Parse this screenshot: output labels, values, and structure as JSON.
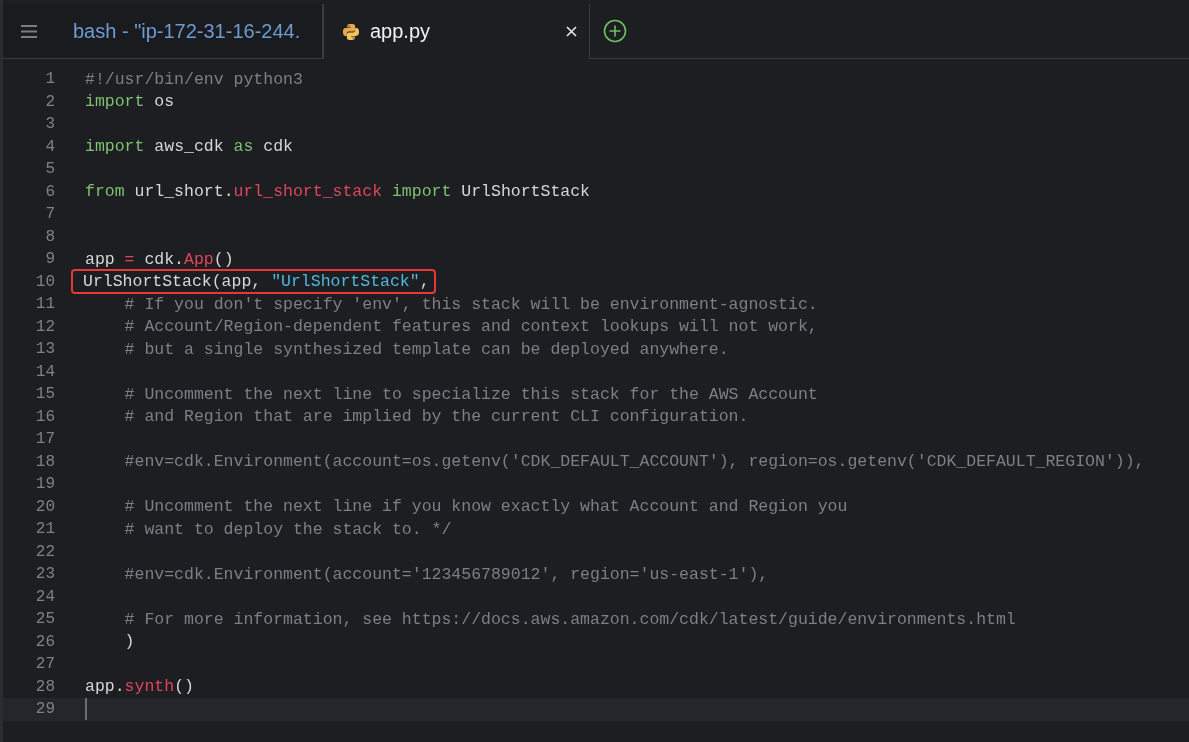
{
  "tabs": [
    {
      "label": "bash - \"ip-172-31-16-244.",
      "kind": "terminal",
      "selected": false
    },
    {
      "label": "app.py",
      "kind": "python",
      "selected": true
    }
  ],
  "editor": {
    "lines": [
      {
        "number": "1",
        "kind": "code",
        "tokens": [
          {
            "kind": "comment",
            "text": "#!/usr/bin/env python3"
          }
        ]
      },
      {
        "number": "2",
        "kind": "code",
        "tokens": [
          {
            "kind": "keyword",
            "text": "import"
          },
          {
            "kind": "plain",
            "text": " os"
          }
        ]
      },
      {
        "number": "3",
        "kind": "code"
      },
      {
        "number": "4",
        "kind": "code",
        "tokens": [
          {
            "kind": "keyword",
            "text": "import"
          },
          {
            "kind": "plain",
            "text": " aws_cdk "
          },
          {
            "kind": "keyword",
            "text": "as"
          },
          {
            "kind": "plain",
            "text": " cdk"
          }
        ]
      },
      {
        "number": "5",
        "kind": "code"
      },
      {
        "number": "6",
        "kind": "code",
        "tokens": [
          {
            "kind": "keyword",
            "text": "from"
          },
          {
            "kind": "plain",
            "text": " url_short."
          },
          {
            "kind": "member",
            "text": "url_short_stack"
          },
          {
            "kind": "keyword",
            "text": " import"
          },
          {
            "kind": "plain",
            "text": " UrlShortStack"
          }
        ]
      },
      {
        "number": "7",
        "kind": "code"
      },
      {
        "number": "8",
        "kind": "code"
      },
      {
        "number": "9",
        "kind": "code",
        "tokens": [
          {
            "kind": "plain",
            "text": "app "
          },
          {
            "kind": "member",
            "text": "="
          },
          {
            "kind": "plain",
            "text": " cdk."
          },
          {
            "kind": "member",
            "text": "App"
          },
          {
            "kind": "plain",
            "text": "()"
          }
        ]
      },
      {
        "number": "10",
        "kind": "boxed",
        "tokens": [
          {
            "kind": "plain",
            "text": "UrlShortStack(app, "
          },
          {
            "kind": "string",
            "text": "\"UrlShortStack\""
          },
          {
            "kind": "plain",
            "text": ","
          }
        ]
      },
      {
        "number": "11",
        "kind": "code",
        "tokens": [
          {
            "kind": "comment",
            "text": "    # If you don't specify 'env', this stack will be environment-agnostic."
          }
        ]
      },
      {
        "number": "12",
        "kind": "code",
        "tokens": [
          {
            "kind": "comment",
            "text": "    # Account/Region-dependent features and context lookups will not work,"
          }
        ]
      },
      {
        "number": "13",
        "kind": "code",
        "tokens": [
          {
            "kind": "comment",
            "text": "    # but a single synthesized template can be deployed anywhere."
          }
        ]
      },
      {
        "number": "14",
        "kind": "code"
      },
      {
        "number": "15",
        "kind": "code",
        "tokens": [
          {
            "kind": "comment",
            "text": "    # Uncomment the next line to specialize this stack for the AWS Account"
          }
        ]
      },
      {
        "number": "16",
        "kind": "code",
        "tokens": [
          {
            "kind": "comment",
            "text": "    # and Region that are implied by the current CLI configuration."
          }
        ]
      },
      {
        "number": "17",
        "kind": "code"
      },
      {
        "number": "18",
        "kind": "code",
        "tokens": [
          {
            "kind": "comment",
            "text": "    #env=cdk.Environment(account=os.getenv('CDK_DEFAULT_ACCOUNT'), region=os.getenv('CDK_DEFAULT_REGION')),"
          }
        ]
      },
      {
        "number": "19",
        "kind": "code"
      },
      {
        "number": "20",
        "kind": "code",
        "tokens": [
          {
            "kind": "comment",
            "text": "    # Uncomment the next line if you know exactly what Account and Region you"
          }
        ]
      },
      {
        "number": "21",
        "kind": "code",
        "tokens": [
          {
            "kind": "comment",
            "text": "    # want to deploy the stack to. */"
          }
        ]
      },
      {
        "number": "22",
        "kind": "code"
      },
      {
        "number": "23",
        "kind": "code",
        "tokens": [
          {
            "kind": "comment",
            "text": "    #env=cdk.Environment(account='123456789012', region='us-east-1'),"
          }
        ]
      },
      {
        "number": "24",
        "kind": "code"
      },
      {
        "number": "25",
        "kind": "code",
        "tokens": [
          {
            "kind": "comment",
            "text": "    # For more information, see https://docs.aws.amazon.com/cdk/latest/guide/environments.html"
          }
        ]
      },
      {
        "number": "26",
        "kind": "code",
        "tokens": [
          {
            "kind": "plain",
            "text": "    )"
          }
        ]
      },
      {
        "number": "27",
        "kind": "code"
      },
      {
        "number": "28",
        "kind": "code",
        "tokens": [
          {
            "kind": "plain",
            "text": "app."
          },
          {
            "kind": "member",
            "text": "synth"
          },
          {
            "kind": "plain",
            "text": "()"
          }
        ]
      },
      {
        "number": "29",
        "kind": "cursor"
      }
    ]
  }
}
